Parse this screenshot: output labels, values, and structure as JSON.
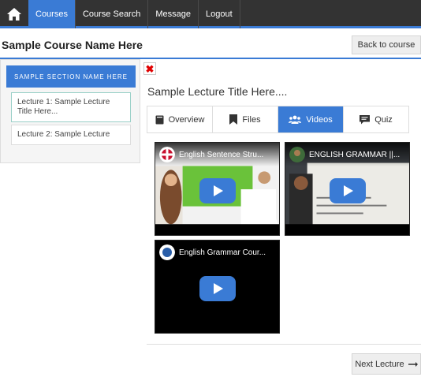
{
  "nav": {
    "home_icon": "home-icon",
    "items": [
      {
        "label": "Courses",
        "active": true
      },
      {
        "label": "Course Search",
        "active": false
      },
      {
        "label": "Message",
        "active": false
      },
      {
        "label": "Logout",
        "active": false
      }
    ]
  },
  "header": {
    "title": "Sample Course Name Here",
    "back_label": "Back to course"
  },
  "sidebar": {
    "section_title": "SAMPLE SECTION NAME HERE",
    "lectures": [
      {
        "label": "Lecture 1: Sample Lecture Title Here..."
      },
      {
        "label": "Lecture 2: Sample Lecture"
      }
    ]
  },
  "lecture": {
    "close_icon": "close-icon",
    "title": "Sample Lecture Title Here....",
    "tabs": [
      {
        "label": "Overview",
        "icon": "book-icon"
      },
      {
        "label": "Files",
        "icon": "bookmark-icon"
      },
      {
        "label": "Videos",
        "icon": "users-icon",
        "active": true
      },
      {
        "label": "Quiz",
        "icon": "chat-icon"
      }
    ],
    "videos": [
      {
        "title": "English Sentence Stru..."
      },
      {
        "title": "ENGLISH GRAMMAR ||..."
      },
      {
        "title": "English Grammar Cour..."
      }
    ]
  },
  "footer": {
    "next_label": "Next Lecture"
  },
  "colors": {
    "accent": "#3a7bd5",
    "nav_bg": "#333333",
    "close": "#e00000"
  }
}
